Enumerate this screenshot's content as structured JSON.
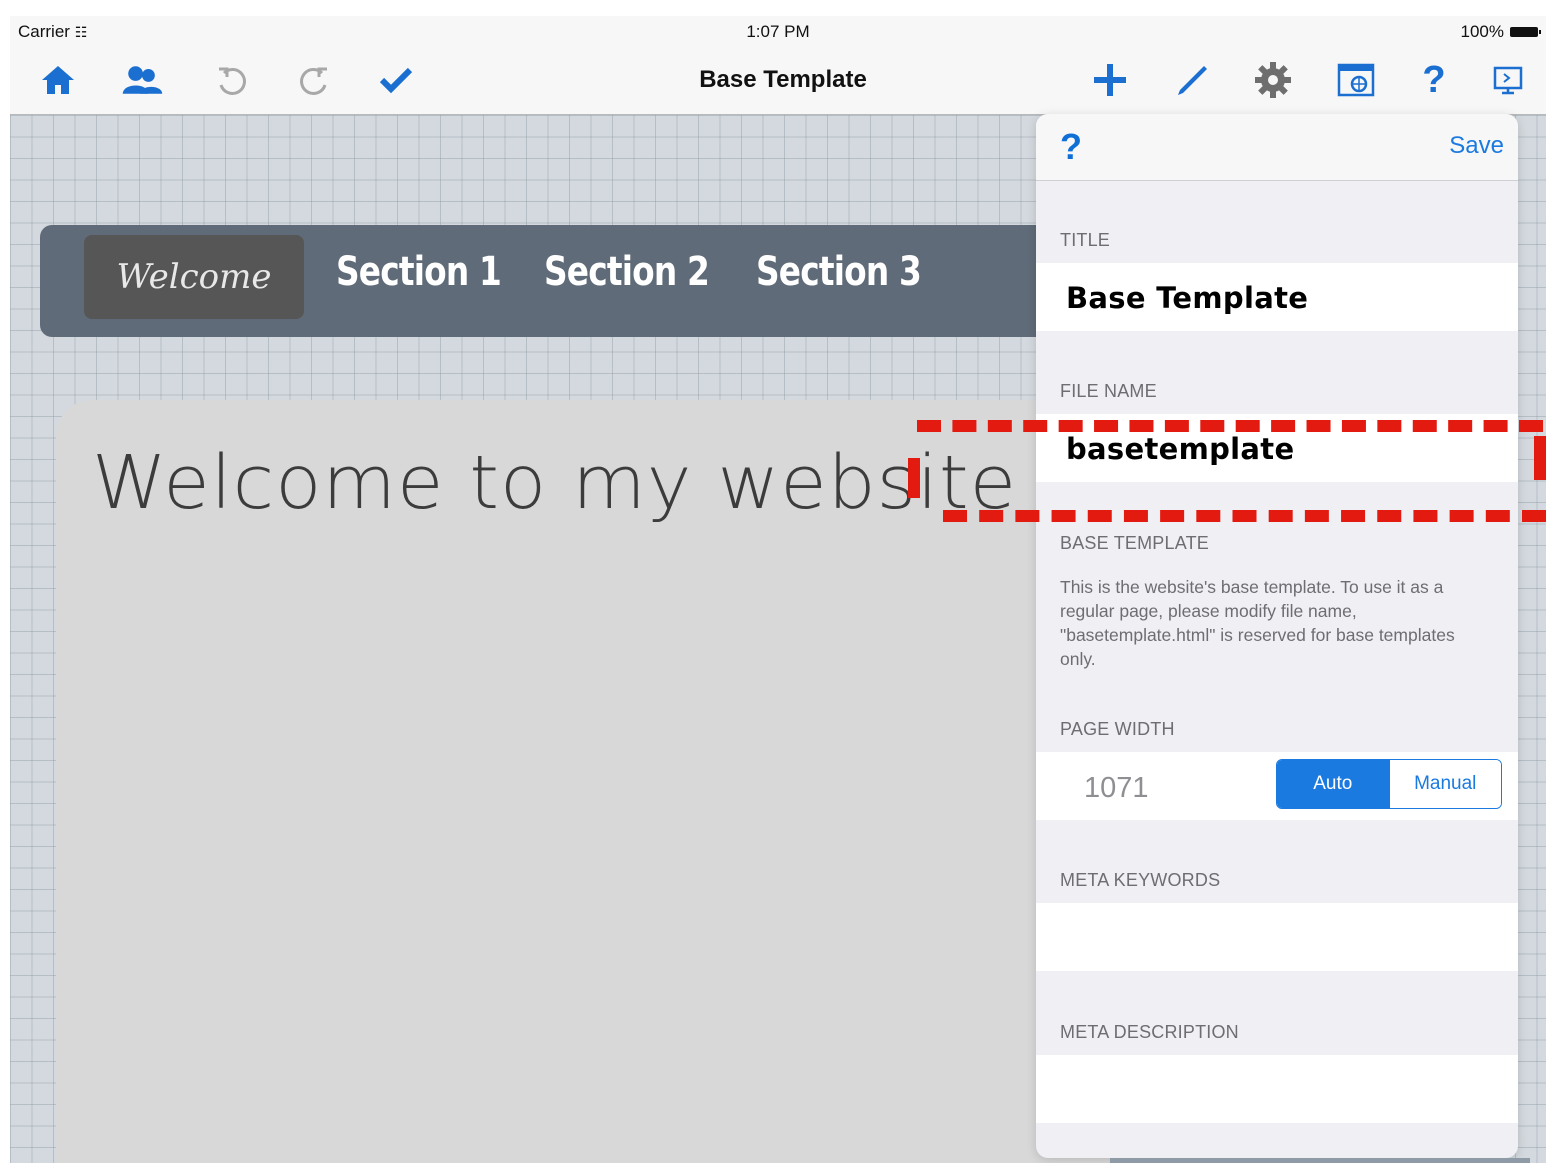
{
  "status_bar": {
    "carrier": "Carrier",
    "time": "1:07 PM",
    "battery": "100%"
  },
  "navbar": {
    "title": "Base Template",
    "left_icons": [
      "home-icon",
      "users-icon",
      "undo-icon",
      "redo-icon",
      "checkmark-icon"
    ],
    "right_icons": [
      "plus-icon",
      "pencil-icon",
      "gear-icon",
      "browser-icon",
      "help-icon",
      "preview-icon"
    ]
  },
  "site": {
    "menu": {
      "welcome": "Welcome",
      "items": [
        "Section 1",
        "Section 2",
        "Section 3"
      ]
    },
    "heading": "Welcome to my website"
  },
  "settings": {
    "help": "?",
    "save": "Save",
    "title_label": "TITLE",
    "title_value": "Base Template",
    "filename_label": "FILE NAME",
    "filename_value": "basetemplate",
    "base_template_label": "BASE TEMPLATE",
    "base_template_desc": "This is the website's base template.  To use it as a regular page, please modify file name, \"basetemplate.html\" is reserved for base templates only.",
    "page_width_label": "PAGE WIDTH",
    "page_width_value": "1071",
    "width_modes": [
      "Auto",
      "Manual"
    ],
    "width_mode_selected": "Auto",
    "meta_keywords_label": "META KEYWORDS",
    "meta_keywords_value": "",
    "meta_description_label": "META DESCRIPTION",
    "meta_description_value": ""
  },
  "colors": {
    "accent": "#1a7ae0",
    "highlight": "#e31a0f"
  }
}
